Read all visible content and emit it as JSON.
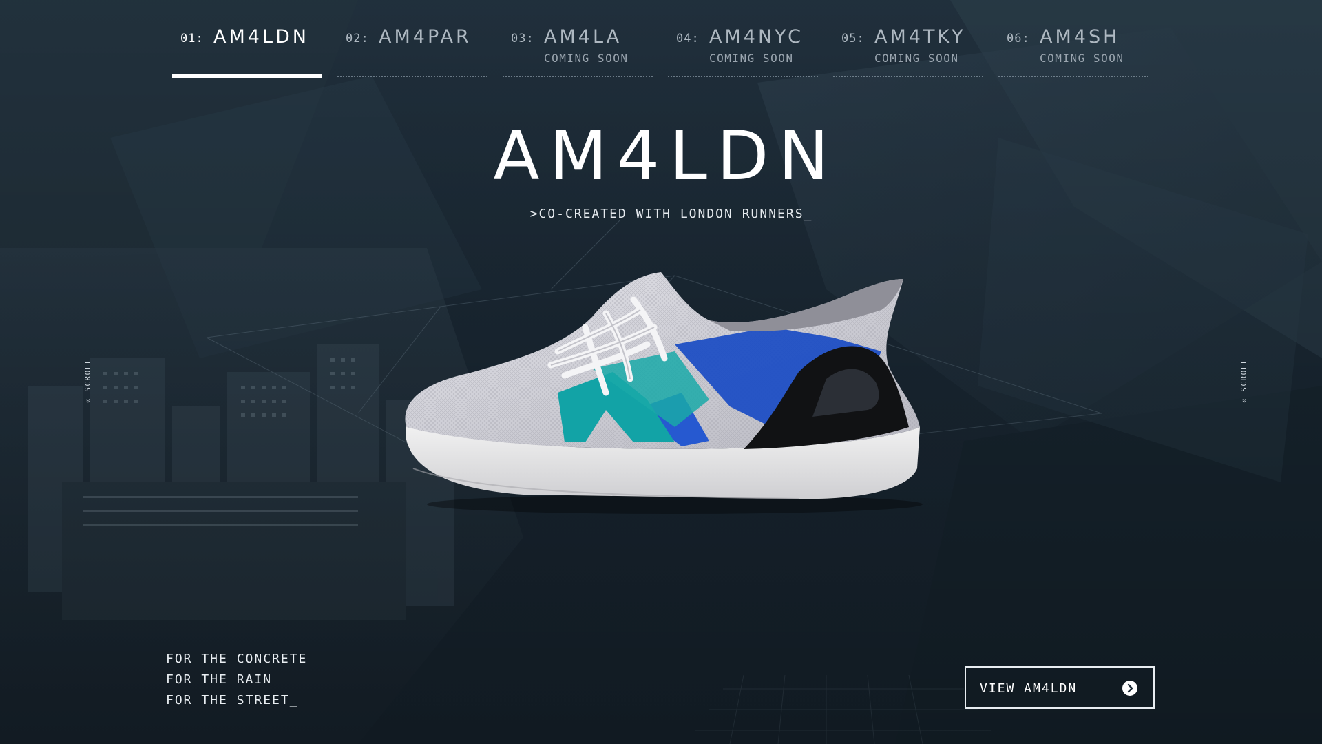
{
  "nav": {
    "items": [
      {
        "num": "01:",
        "name": "AM4LDN",
        "sub": ""
      },
      {
        "num": "02:",
        "name": "AM4PAR",
        "sub": ""
      },
      {
        "num": "03:",
        "name": "AM4LA",
        "sub": "COMING SOON"
      },
      {
        "num": "04:",
        "name": "AM4NYC",
        "sub": "COMING SOON"
      },
      {
        "num": "05:",
        "name": "AM4TKY",
        "sub": "COMING SOON"
      },
      {
        "num": "06:",
        "name": "AM4SH",
        "sub": "COMING SOON"
      }
    ],
    "active_index": 0
  },
  "hero": {
    "title": "AM4LDN",
    "subtitle": ">CO-CREATED WITH LONDON RUNNERS_"
  },
  "scroll": {
    "left_label": "« SCROLL",
    "right_label": "« SCROLL"
  },
  "tagline": {
    "lines": [
      "FOR THE CONCRETE",
      "FOR THE RAIN",
      "FOR THE STREET_"
    ]
  },
  "cta": {
    "label": "VIEW AM4LDN",
    "icon": "chevron-right-circle-icon"
  },
  "product": {
    "icon": "running-shoe-image"
  },
  "colors": {
    "background": "#1c2a36",
    "text": "#ffffff",
    "muted": "#aeb8c1",
    "shoe_blue": "#1f4fc4",
    "shoe_teal": "#12a3a6",
    "shoe_knit": "#d6d6dc"
  }
}
